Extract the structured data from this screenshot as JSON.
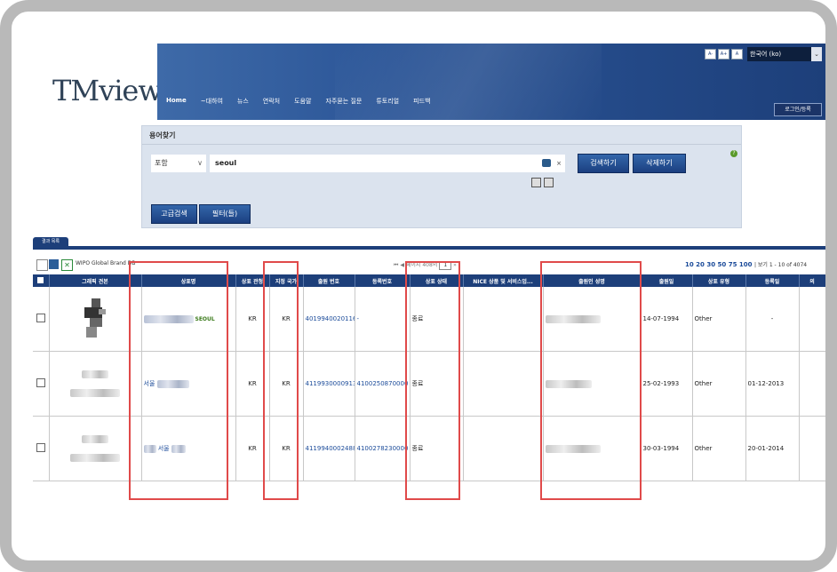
{
  "header": {
    "logo": "TMview",
    "nav": [
      "Home",
      "~대하여",
      "뉴스",
      "연락처",
      "도움말",
      "자주묻는 질문",
      "튜토리얼",
      "피드백"
    ],
    "font_buttons": [
      "A-",
      "A+",
      "A"
    ],
    "language": "한국어 (ko)",
    "login": "로그인/등록"
  },
  "search": {
    "title": "용어찾기",
    "match_type": "포함",
    "query": "seoul",
    "search_button": "검색하기",
    "delete_button": "삭제하기",
    "advanced_button": "고급검색",
    "filter_button": "필터(들)",
    "help": "?"
  },
  "results": {
    "tab_label": "결과 목록",
    "db_label": "WIPO Global Brand DB",
    "pager_label": "페이지 408의",
    "page_number": "1",
    "page_sizes": "10 20 30 50 75 100",
    "range_info": "| 보기 1 - 10 of 4074",
    "columns": [
      "",
      "그래픽 견본",
      "상표명",
      "상표 관청",
      "지정 국가",
      "출원 번호",
      "등록번호",
      "상표 상태",
      "NICE 상품 및 서비스업...",
      "출원인 성명",
      "출원일",
      "상표 유형",
      "등록일",
      "의"
    ],
    "rows": [
      {
        "name_suffix": "SEOUL",
        "office": "KR",
        "designated": "KR",
        "app_no": "4019940020116",
        "reg_no": "-",
        "status": "종료",
        "app_date": "14-07-1994",
        "type": "Other",
        "reg_date": "-"
      },
      {
        "name_suffix": "서울",
        "office": "KR",
        "designated": "KR",
        "app_no": "4119930000913",
        "reg_no": "4100250870000",
        "status": "종료",
        "app_date": "25-02-1993",
        "type": "Other",
        "reg_date": "01-12-2013"
      },
      {
        "name_suffix": "서울",
        "office": "KR",
        "designated": "KR",
        "app_no": "4119940002488",
        "reg_no": "4100278230000",
        "status": "종료",
        "app_date": "30-03-1994",
        "type": "Other",
        "reg_date": "20-01-2014"
      }
    ]
  },
  "colors": {
    "header_blue": "#1d3f7a",
    "link_blue": "#1a4a99",
    "highlight_red": "#e04a4a"
  }
}
